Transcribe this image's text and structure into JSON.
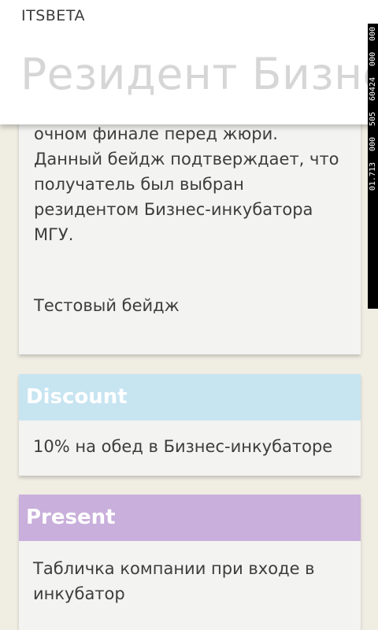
{
  "app": {
    "name": "ITSBETA",
    "page_title": "Резидент Бизнес-инкубатора МГУ"
  },
  "badge": {
    "description": "очном финале перед жюри. Данный бейдж подтверждает, что получатель был выбран резидентом Бизнес-инкубатора МГУ.",
    "name": "Тестовый бейдж"
  },
  "offers": [
    {
      "title": "Discount",
      "text": "10% на обед в Бизнес-инкубаторе",
      "color": "#c7e4f1"
    },
    {
      "title": "Present",
      "text": "Табличка компании при входе в инкубатор",
      "color": "#c9afdb"
    }
  ],
  "status_strip": {
    "values": [
      "000",
      "000",
      "60424",
      "505",
      "000",
      "01.713"
    ]
  }
}
